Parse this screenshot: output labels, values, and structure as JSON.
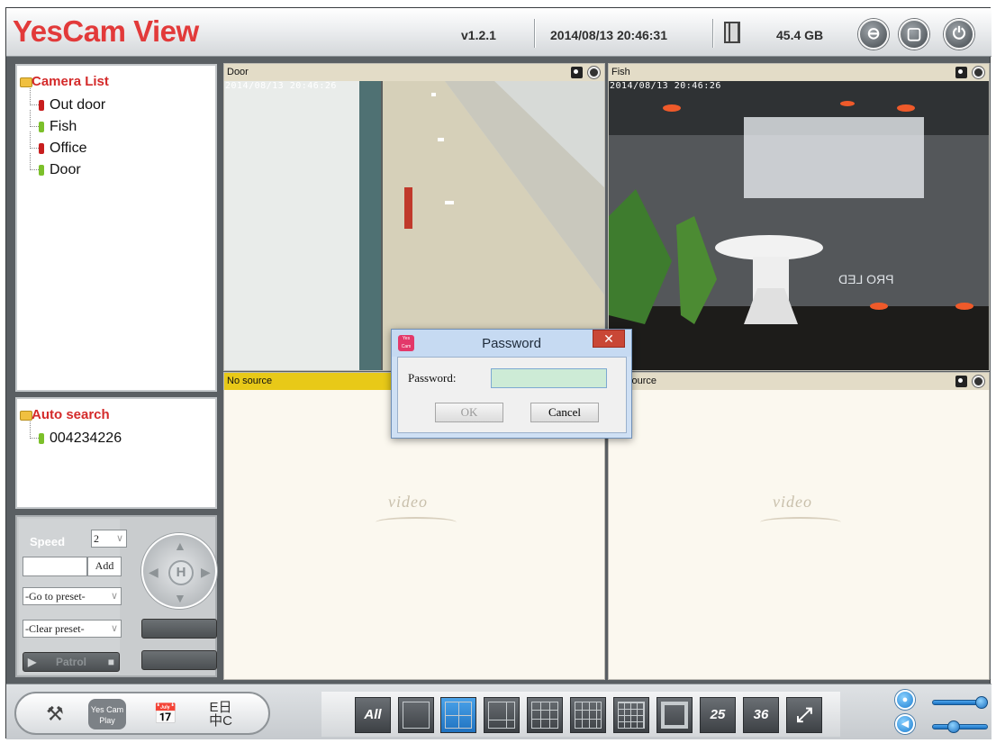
{
  "header": {
    "logo": "YesCam View",
    "version": "v1.2.1",
    "datetime": "2014/08/13 20:46:31",
    "storage": "45.4 GB"
  },
  "camera_list": {
    "title": "Camera List",
    "items": [
      {
        "label": "Out door",
        "status": "red"
      },
      {
        "label": "Fish",
        "status": "green"
      },
      {
        "label": "Office",
        "status": "red"
      },
      {
        "label": "Door",
        "status": "green"
      }
    ]
  },
  "auto_search": {
    "title": "Auto search",
    "items": [
      {
        "label": "004234226",
        "status": "green"
      }
    ]
  },
  "ptz": {
    "speed_label": "Speed",
    "speed_value": "2",
    "add_label": "Add",
    "goto_preset": "-Go to preset-",
    "clear_preset": "-Clear preset-",
    "patrol_label": "Patrol",
    "home_label": "H"
  },
  "tiles": [
    {
      "name": "Door",
      "timestamp": "2014/08/13 20:46:26"
    },
    {
      "name": "Fish",
      "timestamp": "2014/08/13 20:46:26",
      "overlay_text": "PRO LED"
    },
    {
      "name": "No source",
      "watermark": "video"
    },
    {
      "name": "source",
      "watermark": "video"
    }
  ],
  "dialog": {
    "title": "Password",
    "field_label": "Password:",
    "ok_label": "OK",
    "cancel_label": "Cancel",
    "close_glyph": "✕",
    "icon_text": "Yes Cam View"
  },
  "footer": {
    "pill_buttons": [
      "tools-icon",
      "YesCam Play",
      "schedule-icon",
      "E日 中C"
    ],
    "yescam_play_line1": "Yes Cam",
    "yescam_play_line2": "Play",
    "lang_line1": "E日",
    "lang_line2": "中C",
    "layouts": [
      "All",
      "1",
      "4",
      "6",
      "9",
      "10",
      "16",
      "8",
      "25",
      "36",
      "fullscreen"
    ],
    "selected_layout": "4",
    "layout_all_label": "All",
    "layout_25_label": "25",
    "layout_36_label": "36",
    "mic_level": 1.0,
    "volume_level": 0.35
  },
  "colors": {
    "logo_red": "#e23a3a",
    "status_red": "#c81e1e",
    "status_green": "#7cc02a",
    "tile_bar": "#e3dcc7",
    "no_source_bar": "#e8c918",
    "selected_layout": "#1f72c0"
  }
}
